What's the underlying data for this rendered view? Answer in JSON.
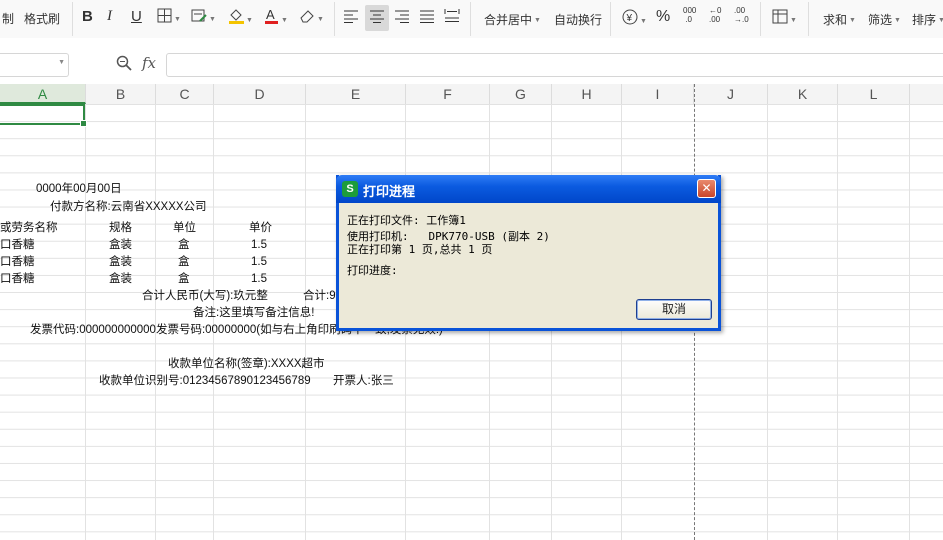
{
  "ribbon": {
    "copy_label": "制",
    "format_painter": "格式刷",
    "bold": "B",
    "italic": "I",
    "underline": "U",
    "merge_center": "合并居中",
    "wrap_text": "自动换行",
    "percent": "%",
    "sum": "求和",
    "filter": "筛选",
    "sort": "排序"
  },
  "formula_bar": {
    "fx": "fx",
    "value": ""
  },
  "columns": [
    "A",
    "B",
    "C",
    "D",
    "E",
    "F",
    "G",
    "H",
    "I",
    "J",
    "K",
    "L"
  ],
  "sheet": {
    "date": "0000年00月00日",
    "payer": "付款方名称:云南省XXXXX公司",
    "header_name": "或劳务名称",
    "header_spec": "规格",
    "header_unit": "单位",
    "header_price": "单价",
    "rows": [
      {
        "name": "口香糖",
        "spec": "盒装",
        "unit": "盒",
        "price": "1.5"
      },
      {
        "name": "口香糖",
        "spec": "盒装",
        "unit": "盒",
        "price": "1.5"
      },
      {
        "name": "口香糖",
        "spec": "盒装",
        "unit": "盒",
        "price": "1.5"
      }
    ],
    "total_rmb": "合计人民币(大写):玖元整",
    "total_label": "合计:9",
    "remark": "备注:这里填写备注信息!",
    "invoice_code": "发票代码:000000000000发票号码:00000000(如与右上角印刷码不一致,发票无效!)",
    "payee_name": "收款单位名称(签章):XXXX超市",
    "payee_id": "收款单位识别号:01234567890123456789",
    "drawer": "开票人:张三"
  },
  "dialog": {
    "title": "打印进程",
    "printing_file_label": "正在打印文件:",
    "printing_file": "工作簿1",
    "printer_label": "使用打印机:",
    "printer": "DPK770-USB (副本 2)",
    "page_status": "正在打印第 1 页,总共 1 页",
    "progress_label": "打印进度:",
    "cancel_label": "取消"
  },
  "colors": {
    "accent": "#2f8a43",
    "dialog_title": "#0b5be0"
  }
}
